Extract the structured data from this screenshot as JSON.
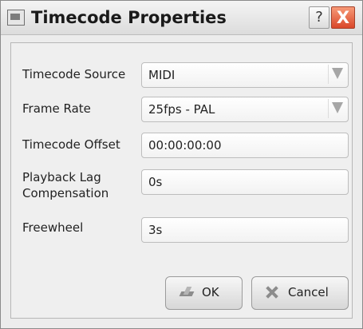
{
  "window": {
    "title": "Timecode Properties",
    "help_label": "?",
    "close_label": "X"
  },
  "form": {
    "fields": [
      {
        "label": "Timecode Source",
        "value": "MIDI",
        "type": "select"
      },
      {
        "label": "Frame Rate",
        "value": "25fps - PAL",
        "type": "select"
      },
      {
        "label": "Timecode Offset",
        "value": "00:00:00:00",
        "type": "text"
      },
      {
        "label_line1": "Playback Lag",
        "label_line2": "Compensation",
        "value": "0s",
        "type": "text"
      },
      {
        "label": "Freewheel",
        "value": "3s",
        "type": "text"
      }
    ]
  },
  "buttons": {
    "ok_label": "OK",
    "cancel_label": "Cancel"
  }
}
